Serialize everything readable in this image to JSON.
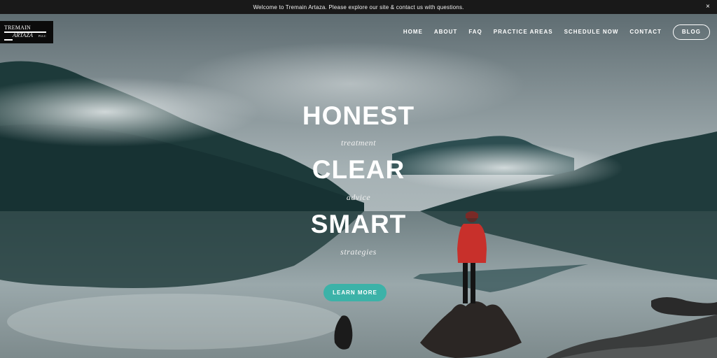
{
  "announcement": {
    "text": "Welcome to Tremain Artaza.  Please explore our site & contact us with questions.",
    "close_label": "×"
  },
  "logo": {
    "line1": "TREMAIN",
    "line2": "ARTAZA",
    "suffix": "PLLC"
  },
  "nav": {
    "items": [
      "HOME",
      "ABOUT",
      "FAQ",
      "PRACTICE AREAS",
      "SCHEDULE NOW",
      "CONTACT"
    ],
    "blog_label": "BLOG"
  },
  "hero": {
    "word1": "HONEST",
    "sub1": "treatment",
    "word2": "CLEAR",
    "sub2": "advice",
    "word3": "SMART",
    "sub3": "strategies",
    "cta_label": "LEARN MORE"
  },
  "colors": {
    "accent": "#3cb2a8",
    "announcement_bg": "#191919",
    "jacket": "#c8302b"
  }
}
